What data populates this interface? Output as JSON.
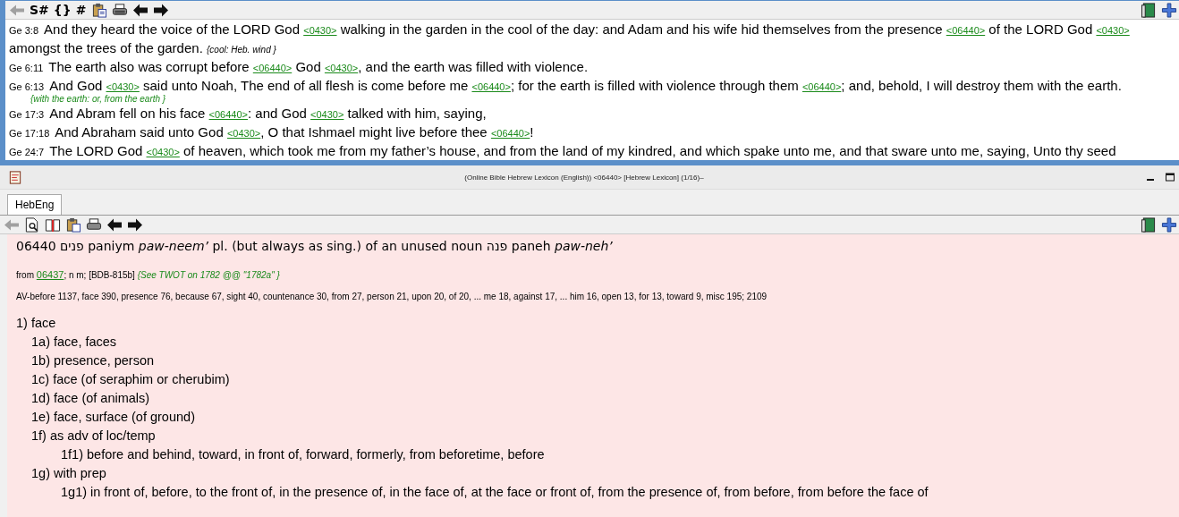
{
  "verse_pane": {
    "back_button": {
      "disabled": true
    },
    "glyph_buttons": [
      "S#",
      "{}",
      "#"
    ],
    "verses": [
      {
        "ref": "Ge 3:8",
        "segments": [
          {
            "kind": "text",
            "text": "And they heard the voice of the LORD God "
          },
          {
            "kind": "link",
            "text": "<0430>"
          },
          {
            "kind": "text",
            "text": " walking in the garden in the cool of the day: and Adam and his wife hid themselves from the presence "
          },
          {
            "kind": "link",
            "text": "<06440>"
          },
          {
            "kind": "text",
            "text": " of the LORD God "
          },
          {
            "kind": "link",
            "text": "<0430>"
          },
          {
            "kind": "text",
            "text": " amongst the trees of the garden. "
          },
          {
            "kind": "note",
            "text": "{cool: Heb. wind }"
          }
        ]
      },
      {
        "ref": "Ge 6:11",
        "segments": [
          {
            "kind": "text",
            "text": "The earth also was corrupt before "
          },
          {
            "kind": "link",
            "text": "<06440>"
          },
          {
            "kind": "text",
            "text": " God "
          },
          {
            "kind": "link",
            "text": "<0430>"
          },
          {
            "kind": "text",
            "text": ", and the earth was filled with violence."
          }
        ]
      },
      {
        "ref": "Ge 6:13",
        "segments": [
          {
            "kind": "text",
            "text": "And God "
          },
          {
            "kind": "link",
            "text": "<0430>"
          },
          {
            "kind": "text",
            "text": " said unto Noah, The end of all flesh is come before me "
          },
          {
            "kind": "link",
            "text": "<06440>"
          },
          {
            "kind": "text",
            "text": "; for the earth is filled with violence through them "
          },
          {
            "kind": "link",
            "text": "<06440>"
          },
          {
            "kind": "text",
            "text": "; and, behold, I will destroy them with the earth."
          },
          {
            "kind": "note_line",
            "text": "{with the earth: or, from the earth }"
          }
        ]
      },
      {
        "ref": "Ge 17:3",
        "segments": [
          {
            "kind": "text",
            "text": "And Abram fell on his face "
          },
          {
            "kind": "link",
            "text": "<06440>"
          },
          {
            "kind": "text",
            "text": ": and God "
          },
          {
            "kind": "link",
            "text": "<0430>"
          },
          {
            "kind": "text",
            "text": " talked with him, saying,"
          }
        ]
      },
      {
        "ref": "Ge 17:18",
        "segments": [
          {
            "kind": "text",
            "text": "And Abraham said unto God "
          },
          {
            "kind": "link",
            "text": "<0430>"
          },
          {
            "kind": "text",
            "text": ", O that Ishmael might live before thee "
          },
          {
            "kind": "link",
            "text": "<06440>"
          },
          {
            "kind": "text",
            "text": "!"
          }
        ]
      },
      {
        "ref": "Ge 24:7",
        "segments": [
          {
            "kind": "text",
            "text": "The LORD God "
          },
          {
            "kind": "link",
            "text": "<0430>"
          },
          {
            "kind": "text",
            "text": " of heaven, which took me from my father’s house, and from the land of my kindred, and which spake unto me, and that sware unto me, saying, Unto thy seed"
          }
        ]
      }
    ]
  },
  "lexicon_pane": {
    "title": "(Online Bible Hebrew Lexicon (English)) <06440> [Hebrew Lexicon] (1/16)–",
    "tabs": [
      {
        "label": "HebEng",
        "selected": true
      }
    ],
    "back_button": {
      "disabled": true
    },
    "headword": "06440 פנים paniym *paw-neem’* pl. (but always as sing.) of an unused noun פנה paneh *paw-neh’*",
    "etymology": [
      {
        "kind": "text",
        "text": "from "
      },
      {
        "kind": "link",
        "text": "06437"
      },
      {
        "kind": "text",
        "text": "; n m; [BDB-815b] "
      },
      {
        "kind": "note",
        "text": "{See TWOT on 1782 @@ \"1782a\" }"
      }
    ],
    "av_usage": "AV-before 1137, face 390, presence 76, because 67, sight 40, countenance 30, from 27, person 21, upon 20, of 20,  ... me 18, against 17,  ... him 16, open 13, for 13, toward 9, misc 195; 2109",
    "outline": [
      {
        "label": "1) face",
        "children": [
          {
            "label": "1a) face, faces"
          },
          {
            "label": "1b) presence, person"
          },
          {
            "label": "1c) face (of seraphim or cherubim)"
          },
          {
            "label": "1d) face (of animals)"
          },
          {
            "label": "1e) face, surface (of ground)"
          },
          {
            "label": "1f) as adv of loc/temp",
            "children": [
              {
                "label": "1f1) before and behind, toward, in front of, forward, formerly, from beforetime, before"
              }
            ]
          },
          {
            "label": "1g) with prep",
            "children": [
              {
                "label": "1g1) in front of, before, to the front of, in the presence of, in the face of, at the face or front of, from the presence of, from before, from before the face of"
              }
            ]
          }
        ]
      }
    ]
  }
}
